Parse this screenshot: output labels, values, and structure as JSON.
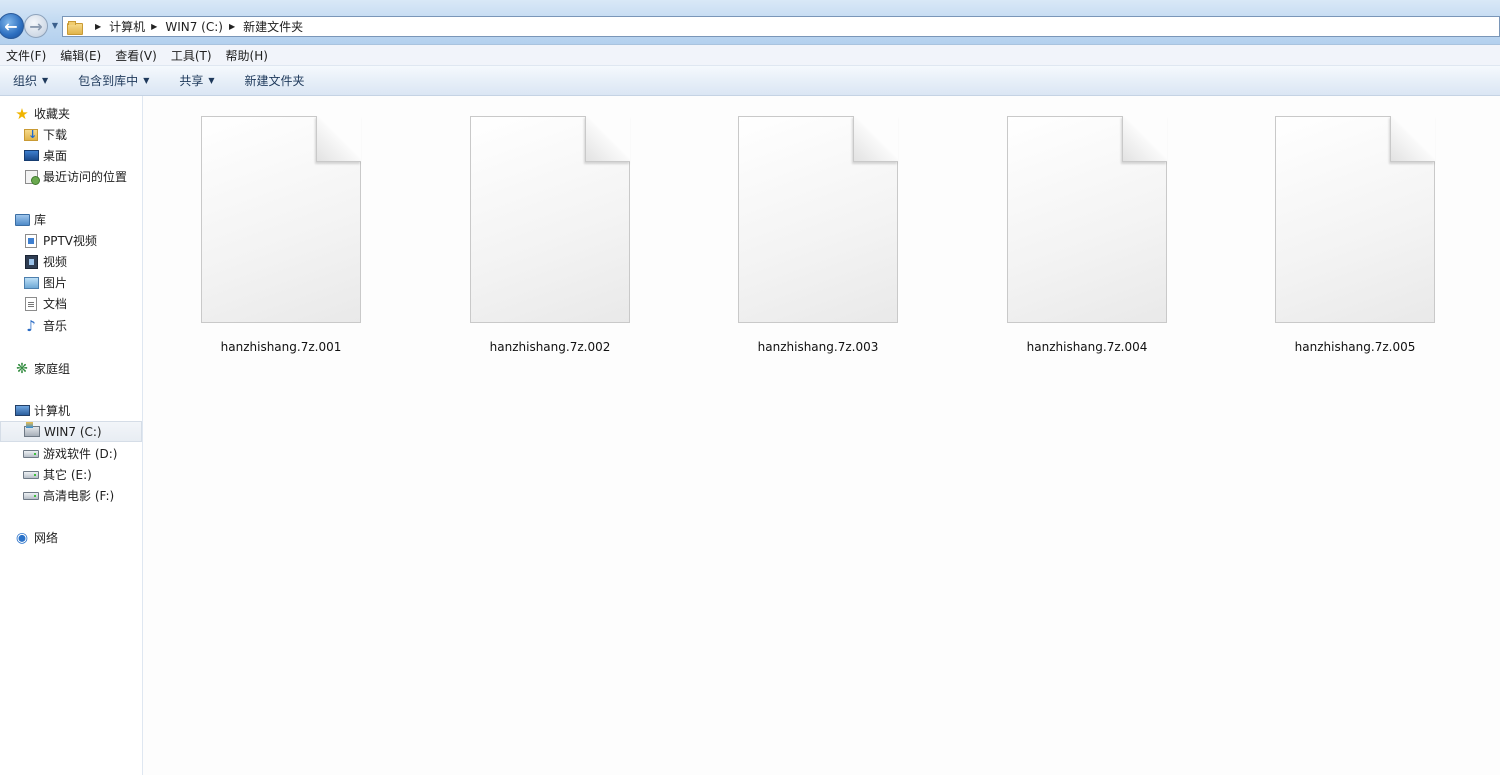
{
  "address_bar": {
    "breadcrumbs": [
      "计算机",
      "WIN7 (C:)",
      "新建文件夹"
    ]
  },
  "menu_bar": {
    "items": [
      "文件(F)",
      "编辑(E)",
      "查看(V)",
      "工具(T)",
      "帮助(H)"
    ]
  },
  "command_bar": {
    "organize": "组织",
    "include_in_library": "包含到库中",
    "share": "共享",
    "new_folder": "新建文件夹"
  },
  "nav_pane": {
    "favorites": {
      "label": "收藏夹",
      "items": [
        "下载",
        "桌面",
        "最近访问的位置"
      ]
    },
    "libraries": {
      "label": "库",
      "items": [
        "PPTV视频",
        "视频",
        "图片",
        "文档",
        "音乐"
      ]
    },
    "homegroup": {
      "label": "家庭组"
    },
    "computer": {
      "label": "计算机",
      "items": [
        "WIN7 (C:)",
        "游戏软件 (D:)",
        "其它 (E:)",
        "高清电影 (F:)"
      ],
      "selected": "WIN7 (C:)"
    },
    "network": {
      "label": "网络"
    }
  },
  "files": [
    {
      "name": "hanzhishang.7z.001"
    },
    {
      "name": "hanzhishang.7z.002"
    },
    {
      "name": "hanzhishang.7z.003"
    },
    {
      "name": "hanzhishang.7z.004"
    },
    {
      "name": "hanzhishang.7z.005"
    }
  ],
  "colors": {
    "titlebar": "#c4dbf2",
    "cmdbar": "#e7eff8",
    "content_bg": "#fdfdfd",
    "selection": "#e8edf3"
  }
}
